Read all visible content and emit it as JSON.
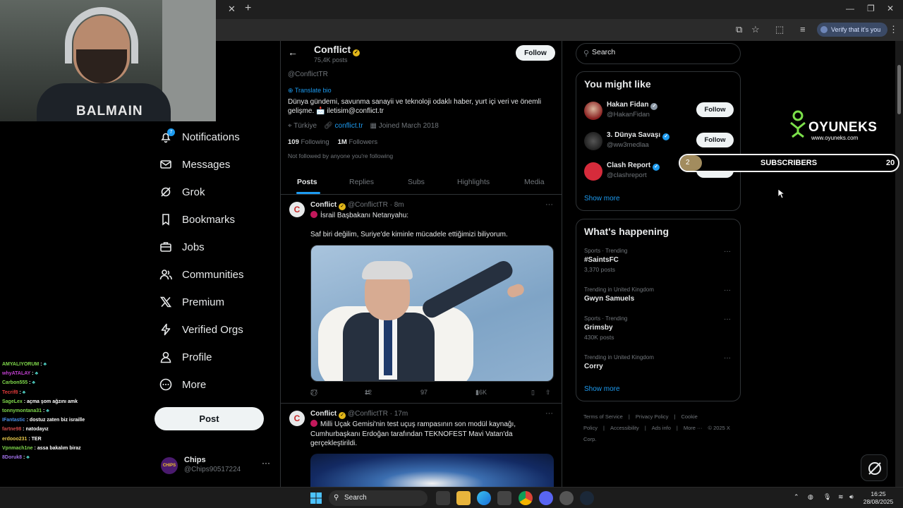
{
  "browser": {
    "verify_label": "Verify that it's you"
  },
  "webcam": {
    "shirt_text": "BALMAIN"
  },
  "nav": {
    "notifications_badge": "7",
    "items": [
      {
        "label": "Notifications",
        "icon": "bell-icon"
      },
      {
        "label": "Messages",
        "icon": "envelope-icon"
      },
      {
        "label": "Grok",
        "icon": "grok-icon"
      },
      {
        "label": "Bookmarks",
        "icon": "bookmark-icon"
      },
      {
        "label": "Jobs",
        "icon": "briefcase-icon"
      },
      {
        "label": "Communities",
        "icon": "people-icon"
      },
      {
        "label": "Premium",
        "icon": "x-logo-icon"
      },
      {
        "label": "Verified Orgs",
        "icon": "lightning-icon"
      },
      {
        "label": "Profile",
        "icon": "person-icon"
      },
      {
        "label": "More",
        "icon": "more-circle-icon"
      }
    ],
    "post_button": "Post",
    "account": {
      "name": "Chips",
      "handle": "@Chips90517224",
      "avatar_text": "CHIPS"
    }
  },
  "chat": [
    {
      "user": "AMYALIYORUM",
      "msg": "",
      "color": "#7fd84b"
    },
    {
      "user": "whyATALAY",
      "msg": "",
      "color": "#c040d0"
    },
    {
      "user": "Carbon555",
      "msg": "",
      "color": "#7fd84b"
    },
    {
      "user": "Tecrif8",
      "msg": "",
      "color": "#e03a3a"
    },
    {
      "user": "SageLex",
      "msg": "açma şom ağzını amk",
      "color": "#7fd84b"
    },
    {
      "user": "tonnymontana31",
      "msg": "",
      "color": "#7fd84b"
    },
    {
      "user": "IFantastic",
      "msg": "dostuz zaten biz israille",
      "color": "#4a8fe8"
    },
    {
      "user": "fartne98",
      "msg": "natodayız",
      "color": "#d04a4a"
    },
    {
      "user": "erdooo231",
      "msg": "TER",
      "color": "#e8c84a"
    },
    {
      "user": "Vpnmach1ne",
      "msg": "assa bakalım biraz",
      "color": "#7fd84b"
    },
    {
      "user": "8Doruk8",
      "msg": "",
      "color": "#a070e8"
    }
  ],
  "profile": {
    "name": "Conflict",
    "post_count": "75,4K posts",
    "follow_label": "Follow",
    "handle": "@ConflictTR",
    "translate_label": "Translate bio",
    "bio": "Dünya gündemi, savunma sanayii ve teknoloji odaklı haber, yurt içi veri ve önemli gelişme. 📩 iletisim@conflict.tr",
    "location": "Türkiye",
    "website": "conflict.tr",
    "joined": "Joined March 2018",
    "following_count": "109",
    "following_label": "Following",
    "followers_count": "1M",
    "followers_label": "Followers",
    "followed_by": "Not followed by anyone you're following",
    "tabs": [
      "Posts",
      "Replies",
      "Subs",
      "Highlights",
      "Media"
    ]
  },
  "posts": [
    {
      "name": "Conflict",
      "handle": "@ConflictTR",
      "time": "8m",
      "line1": "İsrail Başbakanı Netanyahu:",
      "line2": "Saf biri değilim, Suriye'de kiminle mücadele ettiğimizi biliyorum.",
      "replies": "27",
      "reposts": "12",
      "likes": "97",
      "views": "16K"
    },
    {
      "name": "Conflict",
      "handle": "@ConflictTR",
      "time": "17m",
      "text": "Milli Uçak Gemisi'nin test uçuş rampasının son modül kaynağı, Cumhurbaşkanı Erdoğan tarafından TEKNOFEST Mavi Vatan'da gerçekleştirildi."
    }
  ],
  "sidebar": {
    "search_placeholder": "Search",
    "might_like_title": "You might like",
    "suggestions": [
      {
        "name": "Hakan Fidan",
        "handle": "@HakanFidan",
        "badge": "gray",
        "button": "Follow"
      },
      {
        "name": "3. Dünya Savaşı",
        "handle": "@ww3medlaa",
        "badge": "blue",
        "button": "Follow"
      },
      {
        "name": "Clash Report",
        "handle": "@clashreport",
        "badge": "blue",
        "button": "Follow"
      }
    ],
    "show_more": "Show more",
    "happening_title": "What's happening",
    "trends": [
      {
        "context": "Sports · Trending",
        "title": "#SaintsFC",
        "count": "3,370 posts"
      },
      {
        "context": "Trending in United Kingdom",
        "title": "Gwyn Samuels",
        "count": ""
      },
      {
        "context": "Sports · Trending",
        "title": "Grimsby",
        "count": "430K posts"
      },
      {
        "context": "Trending in United Kingdom",
        "title": "Corry",
        "count": ""
      }
    ],
    "footer": [
      "Terms of Service",
      "|",
      "Privacy Policy",
      "|",
      "Cookie Policy",
      "|",
      "Accessibility",
      "|",
      "Ads info",
      "|",
      "More ···",
      "© 2025 X Corp."
    ]
  },
  "overlay": {
    "logo_word": "OYUNEKS",
    "logo_url": "www.oyuneks.com",
    "subs_current": "2",
    "subs_label": "SUBSCRIBERS",
    "subs_goal": "20",
    "subs_progress": 0.1
  },
  "taskbar": {
    "search_label": "Search",
    "time": "16:25",
    "date": "28/08/2025"
  },
  "colors": {
    "accent": "#1d9bf0",
    "background": "#000000",
    "border": "#2f3336",
    "muted_text": "#71767b"
  }
}
